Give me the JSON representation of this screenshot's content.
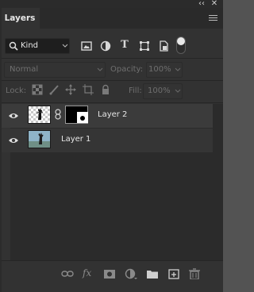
{
  "window": {
    "collapse_icon": "double-chevron-left-icon",
    "close_icon": "close-icon",
    "collapse_glyph": "‹‹",
    "close_glyph": "✕"
  },
  "panel": {
    "title": "Layers",
    "menu_icon": "panel-menu-icon"
  },
  "filter": {
    "kind_label": "Kind",
    "icons": [
      "pixel-filter-icon",
      "adjustment-filter-icon",
      "type-filter-icon",
      "shape-filter-icon",
      "smart-object-filter-icon"
    ],
    "type_glyph": "T"
  },
  "blend": {
    "mode": "Normal",
    "opacity_label": "Opacity:",
    "opacity_value": "100%"
  },
  "lock": {
    "label": "Lock:",
    "fill_label": "Fill:",
    "fill_value": "100%"
  },
  "layers": [
    {
      "name": "Layer 2",
      "visible": true,
      "has_mask": true,
      "selected": true
    },
    {
      "name": "Layer 1",
      "visible": true,
      "has_mask": false,
      "selected": false
    }
  ],
  "bottom_bar": {
    "fx_label": "fx",
    "icons": [
      "link-layers-icon",
      "fx-icon",
      "add-mask-icon",
      "new-fill-adjustment-icon",
      "new-group-icon",
      "new-layer-icon",
      "delete-layer-icon"
    ]
  },
  "colors": {
    "panel_bg": "#323232",
    "row_selected": "#3b3b3b",
    "text": "#e6e6e6"
  }
}
